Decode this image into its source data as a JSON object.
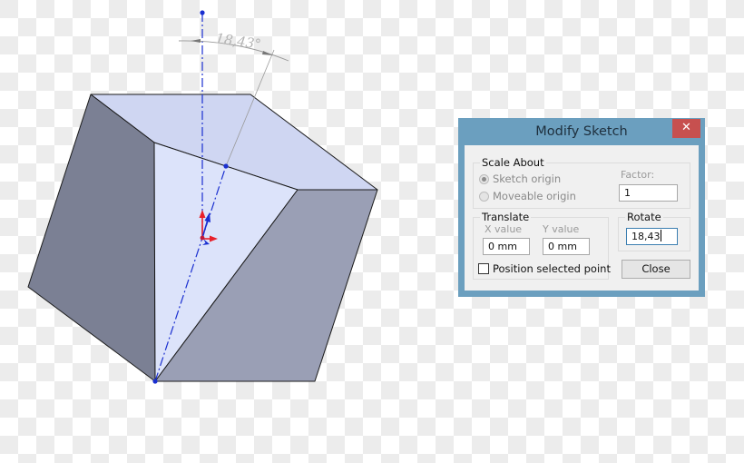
{
  "viewport": {
    "dimension_label": "18,43°",
    "colors": {
      "top_face": "#cfd6f2",
      "front_face": "#dce3fa",
      "left_face": "#7b8094",
      "right_face": "#9a9fb5",
      "edge": "#1a1a1a",
      "sketch_line": "#1a2fd0",
      "axis_red": "#e8202a",
      "dimension_gray": "#9a9a9a"
    }
  },
  "dialog": {
    "title": "Modify Sketch",
    "close_icon_glyph": "✕",
    "scale_about": {
      "label": "Scale About",
      "options": [
        {
          "label": "Sketch origin",
          "selected": true,
          "enabled": false
        },
        {
          "label": "Moveable origin",
          "selected": false,
          "enabled": false
        }
      ],
      "factor_label": "Factor:",
      "factor_value": "1"
    },
    "translate": {
      "label": "Translate",
      "x_label": "X value",
      "x_value": "0 mm",
      "y_label": "Y value",
      "y_value": "0 mm",
      "position_checkbox_label": "Position selected point",
      "position_checked": false
    },
    "rotate": {
      "label": "Rotate",
      "value": "18,43"
    },
    "close_button": "Close"
  }
}
